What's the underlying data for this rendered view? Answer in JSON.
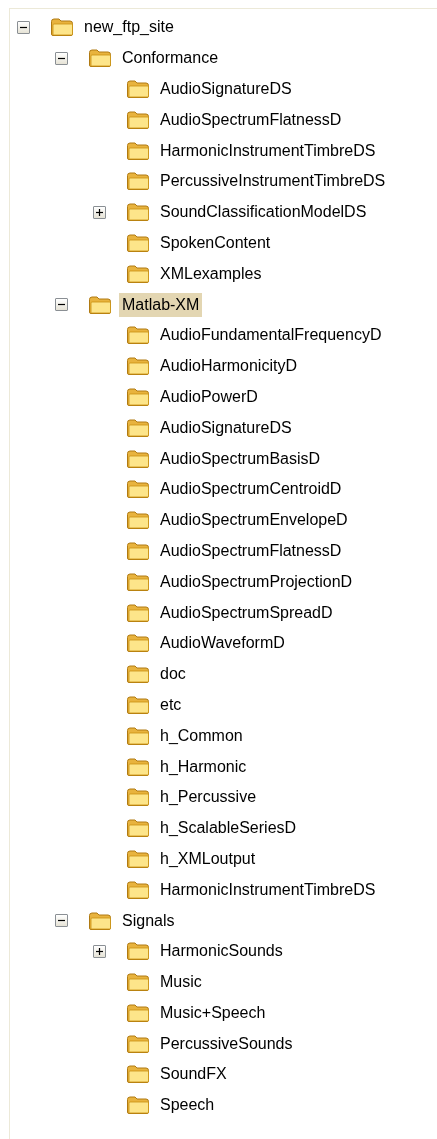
{
  "tree": [
    {
      "label": "new_ftp_site",
      "expanded": true,
      "selected": false,
      "children": [
        {
          "label": "Conformance",
          "expanded": true,
          "selected": false,
          "children": [
            {
              "label": "AudioSignatureDS",
              "selected": false
            },
            {
              "label": "AudioSpectrumFlatnessD",
              "selected": false
            },
            {
              "label": "HarmonicInstrumentTimbreDS",
              "selected": false
            },
            {
              "label": "PercussiveInstrumentTimbreDS",
              "selected": false
            },
            {
              "label": "SoundClassificationModelDS",
              "expanded": false,
              "selected": false
            },
            {
              "label": "SpokenContent",
              "selected": false
            },
            {
              "label": "XMLexamples",
              "selected": false
            }
          ]
        },
        {
          "label": "Matlab-XM",
          "expanded": true,
          "selected": true,
          "children": [
            {
              "label": "AudioFundamentalFrequencyD",
              "selected": false
            },
            {
              "label": "AudioHarmonicityD",
              "selected": false
            },
            {
              "label": "AudioPowerD",
              "selected": false
            },
            {
              "label": "AudioSignatureDS",
              "selected": false
            },
            {
              "label": "AudioSpectrumBasisD",
              "selected": false
            },
            {
              "label": "AudioSpectrumCentroidD",
              "selected": false
            },
            {
              "label": "AudioSpectrumEnvelopeD",
              "selected": false
            },
            {
              "label": "AudioSpectrumFlatnessD",
              "selected": false
            },
            {
              "label": "AudioSpectrumProjectionD",
              "selected": false
            },
            {
              "label": "AudioSpectrumSpreadD",
              "selected": false
            },
            {
              "label": "AudioWaveformD",
              "selected": false
            },
            {
              "label": "doc",
              "selected": false
            },
            {
              "label": "etc",
              "selected": false
            },
            {
              "label": "h_Common",
              "selected": false
            },
            {
              "label": "h_Harmonic",
              "selected": false
            },
            {
              "label": "h_Percussive",
              "selected": false
            },
            {
              "label": "h_ScalableSeriesD",
              "selected": false
            },
            {
              "label": "h_XMLoutput",
              "selected": false
            },
            {
              "label": "HarmonicInstrumentTimbreDS",
              "selected": false
            }
          ]
        },
        {
          "label": "Signals",
          "expanded": true,
          "selected": false,
          "children": [
            {
              "label": "HarmonicSounds",
              "expanded": false,
              "selected": false
            },
            {
              "label": "Music",
              "selected": false
            },
            {
              "label": "Music+Speech",
              "selected": false
            },
            {
              "label": "PercussiveSounds",
              "selected": false
            },
            {
              "label": "SoundFX",
              "selected": false
            },
            {
              "label": "Speech",
              "selected": false
            }
          ]
        }
      ]
    }
  ]
}
